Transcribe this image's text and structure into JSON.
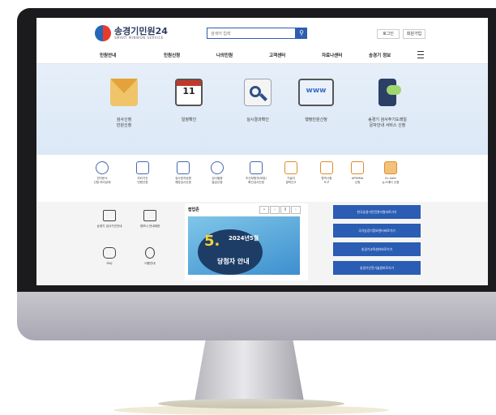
{
  "site": {
    "logo_title": "송경기민원24",
    "logo_subtitle": "SMART MINWON SERVICE",
    "search_placeholder": "검색어 입력",
    "login_label": "로그인",
    "join_label": "회원가입"
  },
  "nav": {
    "items": [
      "민원안내",
      "민원신청",
      "나의민원",
      "고객센터",
      "자료나센터",
      "송경기 정보"
    ]
  },
  "services": [
    {
      "label": "검사신청\n민원신청",
      "icon": "envelope-icon"
    },
    {
      "label": "일정확인",
      "icon": "calendar-icon"
    },
    {
      "label": "실시결과확인",
      "icon": "document-search-icon"
    },
    {
      "label": "행정민원신청",
      "icon": "tablet-web-icon"
    },
    {
      "label": "송경기 검사주기도래일\n문자안내 서비스 신청",
      "icon": "mobile-chat-icon"
    }
  ],
  "calendar_day": "11",
  "quick_links": [
    "전자문서\n신청·처리상태",
    "처리기간\n민원신청",
    "검사방지공원\n예방검사신청",
    "검사필증\n발급신청",
    "조건부합격(보완)\n확인검사신청",
    "기술자\n경력신고",
    "원격시험\n도구",
    "APMIMA\n신청",
    "EL-Safe\n뉴스레터 신청"
  ],
  "tiles": [
    {
      "label": "송경기 검사기관안내",
      "icon": "chart-board-icon"
    },
    {
      "label": "정보나 안내제한",
      "icon": "document-edit-icon"
    },
    {
      "label": "FAQ",
      "icon": "chat-bubble-icon"
    },
    {
      "label": "이용안내",
      "icon": "info-icon"
    }
  ],
  "popup": {
    "title": "팝업존",
    "pager": "II",
    "banner_number": "5.",
    "banner_line1": "2024년5월",
    "banner_line2": "당첨자 안내"
  },
  "link_buttons": [
    "한국송경기안전관리원바로가기",
    "국가승강기정보센터바로가기",
    "송경기교육센터바로가기",
    "송경기안전기술원바로가기"
  ],
  "colors": {
    "brand_blue": "#2a5db3",
    "hero_bg": "#e6eff9"
  }
}
